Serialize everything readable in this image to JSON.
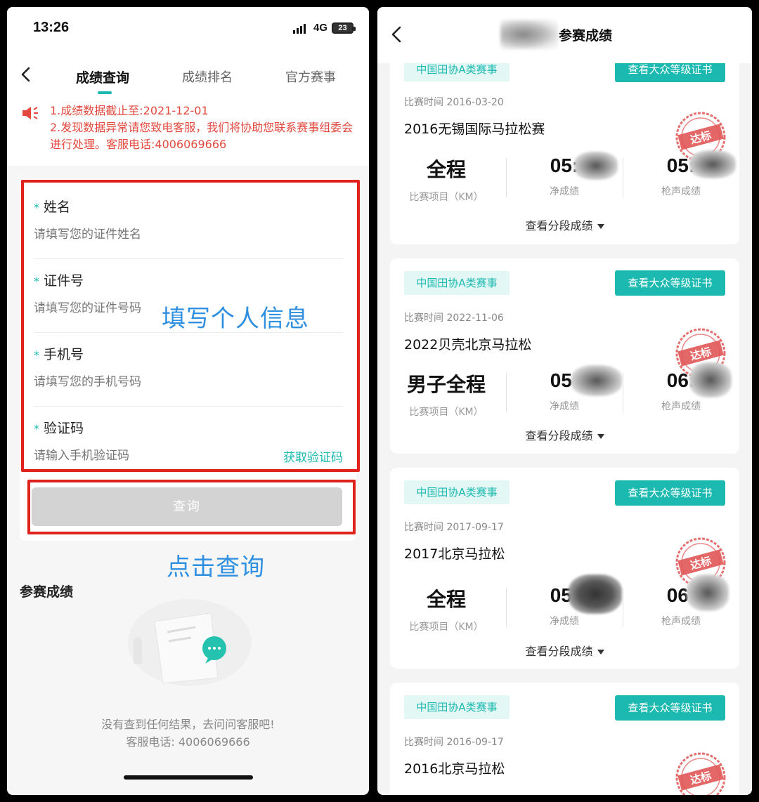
{
  "left": {
    "status": {
      "time": "13:26",
      "network": "4G",
      "battery": "23"
    },
    "tabs": [
      {
        "label": "成绩查询"
      },
      {
        "label": "成绩排名"
      },
      {
        "label": "官方赛事"
      }
    ],
    "notice": {
      "line1": "1.成绩数据截止至:2021-12-01",
      "line2": "2.发现数据异常请您致电客服，我们将协助您联系赛事组委会进行处理。客服电话:4006069666"
    },
    "form": {
      "name_label": "姓名",
      "name_placeholder": "请填写您的证件姓名",
      "id_label": "证件号",
      "id_placeholder": "请填写您的证件号码",
      "phone_label": "手机号",
      "phone_placeholder": "请填写您的手机号码",
      "code_label": "验证码",
      "code_placeholder": "请输入手机验证码",
      "get_code": "获取验证码",
      "submit": "查询"
    },
    "annotations": {
      "fill_info": "填写个人信息",
      "click_query": "点击查询"
    },
    "results": {
      "title": "参赛成绩",
      "empty_line1": "没有查到任何结果，去问问客服吧!",
      "empty_line2": "客服电话: 4006069666"
    }
  },
  "right": {
    "header_title": "参赛成绩",
    "races": [
      {
        "tag": "中国田协A类赛事",
        "cert": "查看大众等级证书",
        "date": "比赛时间 2016-03-20",
        "name": "2016无锡国际马拉松赛",
        "event": "全程",
        "event_label": "比赛项目（KM）",
        "net_prefix": "05:",
        "net_label": "净成绩",
        "gun_prefix": "05:",
        "gun_label": "枪声成绩",
        "seg": "查看分段成绩",
        "stamp": "达标"
      },
      {
        "tag": "中国田协A类赛事",
        "cert": "查看大众等级证书",
        "date": "比赛时间 2022-11-06",
        "name": "2022贝壳北京马拉松",
        "event": "男子全程",
        "event_label": "比赛项目（KM）",
        "net_prefix": "05:",
        "net_label": "净成绩",
        "gun_prefix": "06:",
        "gun_label": "枪声成绩",
        "seg": "查看分段成绩",
        "stamp": "达标"
      },
      {
        "tag": "中国田协A类赛事",
        "cert": "查看大众等级证书",
        "date": "比赛时间 2017-09-17",
        "name": "2017北京马拉松",
        "event": "全程",
        "event_label": "比赛项目（KM）",
        "net_prefix": "05:",
        "net_label": "净成绩",
        "gun_prefix": "06:",
        "gun_label": "枪声成绩",
        "seg": "查看分段成绩",
        "stamp": "达标"
      },
      {
        "tag": "中国田协A类赛事",
        "cert": "查看大众等级证书",
        "date": "比赛时间 2016-09-17",
        "name": "2016北京马拉松",
        "stamp": "达标"
      }
    ]
  },
  "colors": {
    "accent": "#1bb9b0",
    "notice_red": "#e2483d",
    "frame_red": "#e0221d",
    "annotation_blue": "#2f8fe0"
  }
}
